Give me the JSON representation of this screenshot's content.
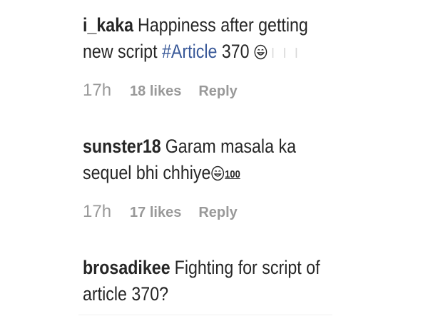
{
  "comments": [
    {
      "username": "i_kaka",
      "text_before": "Happiness after getting new script ",
      "hashtag": "#Article",
      "text_after": " 370",
      "faint_text": "I I I",
      "time": "17h",
      "likes": "18 likes",
      "reply": "Reply"
    },
    {
      "username": "sunster18",
      "text_before": "Garam masala ka sequel bhi chhiye",
      "hundred": "100",
      "time": "17h",
      "likes": "17 likes",
      "reply": "Reply"
    },
    {
      "username": "brosadikee",
      "text_before": "Fighting for script of article 370?"
    }
  ],
  "icons": {
    "emoji_1": "smiling-face-emoji-icon",
    "emoji_2": "smiling-face-emoji-icon"
  },
  "colors": {
    "text": "#262626",
    "meta": "#999999",
    "hashtag": "#385898",
    "divider": "#efefef"
  }
}
